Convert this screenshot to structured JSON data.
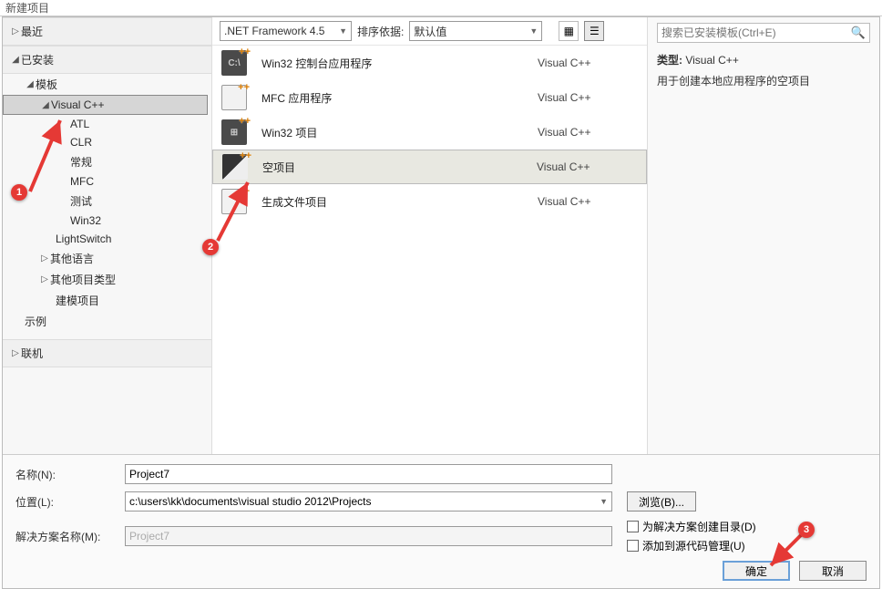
{
  "title": "新建项目",
  "sidebar": {
    "recent": "最近",
    "installed": "已安装",
    "templates": "模板",
    "vcpp": "Visual C++",
    "atl": "ATL",
    "clr": "CLR",
    "general": "常规",
    "mfc": "MFC",
    "test": "测试",
    "win32": "Win32",
    "lightswitch": "LightSwitch",
    "other_lang": "其他语言",
    "other_proj": "其他项目类型",
    "modeling": "建模项目",
    "sample": "示例",
    "online": "联机"
  },
  "toolbar": {
    "framework": ".NET Framework 4.5",
    "sort_label": "排序依据:",
    "sort_value": "默认值"
  },
  "templates": [
    {
      "name": "Win32 控制台应用程序",
      "lang": "Visual C++",
      "icon_text": "C:\\"
    },
    {
      "name": "MFC 应用程序",
      "lang": "Visual C++",
      "icon_text": "",
      "white": true
    },
    {
      "name": "Win32 项目",
      "lang": "Visual C++",
      "icon_text": ""
    },
    {
      "name": "空项目",
      "lang": "Visual C++",
      "icon_text": "",
      "selected": true
    },
    {
      "name": "生成文件项目",
      "lang": "Visual C++",
      "icon_text": "",
      "white": true
    }
  ],
  "rightpane": {
    "search_placeholder": "搜索已安装模板(Ctrl+E)",
    "type_label": "类型:",
    "type_value": "Visual C++",
    "desc": "用于创建本地应用程序的空项目"
  },
  "form": {
    "name_label": "名称(N):",
    "name_value": "Project7",
    "loc_label": "位置(L):",
    "loc_value": "c:\\users\\kk\\documents\\visual studio 2012\\Projects",
    "sol_label": "解决方案名称(M):",
    "sol_value": "Project7",
    "browse": "浏览(B)...",
    "check1": "为解决方案创建目录(D)",
    "check2": "添加到源代码管理(U)",
    "ok": "确定",
    "cancel": "取消"
  },
  "callouts": {
    "c1": "1",
    "c2": "2",
    "c3": "3"
  }
}
